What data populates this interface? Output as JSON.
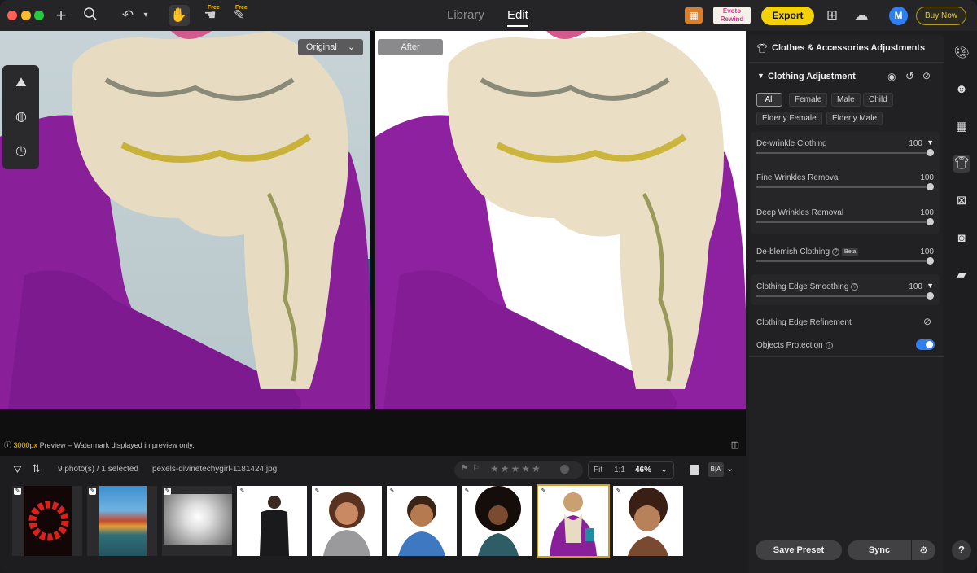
{
  "topbar": {
    "free_badge_1": "Free",
    "free_badge_2": "Free",
    "tabs": [
      {
        "label": "Library"
      },
      {
        "label": "Edit"
      }
    ],
    "export_label": "Export",
    "rewind_label": "Evoto Rewind",
    "avatar_letter": "M",
    "buy_now_label": "Buy Now"
  },
  "canvas": {
    "original_label": "Original",
    "after_label": "After",
    "preview_size": "3000px",
    "preview_notice": " Preview – Watermark displayed in preview only."
  },
  "filmstrip": {
    "count_text": "9 photo(s) / 1 selected",
    "filename": "pexels-divinetechygirl-1181424.jpg",
    "fit_label": "Fit",
    "one_to_one_label": "1:1",
    "zoom_value": "46%",
    "thumbnails": [
      {
        "name": "red-spiral"
      },
      {
        "name": "colorful-buildings"
      },
      {
        "name": "white-corridor"
      },
      {
        "name": "man-in-suit"
      },
      {
        "name": "smiling-woman"
      },
      {
        "name": "smiling-man"
      },
      {
        "name": "curly-hair-woman"
      },
      {
        "name": "scarf-woman",
        "selected": true
      },
      {
        "name": "young-girl"
      }
    ]
  },
  "panel": {
    "section_title": "Clothes & Accessories Adjustments",
    "sub_title": "Clothing Adjustment",
    "chips_row1": [
      "All",
      "Female",
      "Male",
      "Child"
    ],
    "chips_row2": [
      "Elderly Female",
      "Elderly Male"
    ],
    "sliders": [
      {
        "label": "De-wrinkle Clothing",
        "value": "100",
        "dropdown": true
      },
      {
        "label": "Fine Wrinkles Removal",
        "value": "100"
      },
      {
        "label": "Deep Wrinkles Removal",
        "value": "100"
      },
      {
        "label": "De-blemish Clothing",
        "value": "100",
        "beta": "Beta"
      },
      {
        "label": "Clothing Edge Smoothing",
        "value": "100",
        "dropdown": true
      }
    ],
    "edge_refinement_label": "Clothing Edge Refinement",
    "objects_protection_label": "Objects Protection",
    "objects_protection_on": true,
    "save_preset_label": "Save Preset",
    "sync_label": "Sync",
    "help_label": "?"
  },
  "colors": {
    "accent_yellow": "#f5d10a",
    "accent_blue": "#2d7ff2",
    "panel_bg": "#212123"
  }
}
